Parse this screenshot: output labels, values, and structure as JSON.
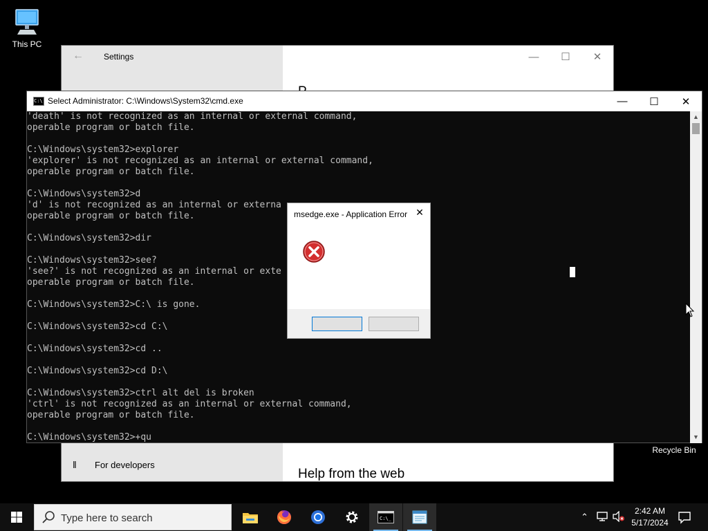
{
  "desktop": {
    "icons": [
      {
        "label": "This PC"
      },
      {
        "label": "Recycle Bin"
      }
    ]
  },
  "settings": {
    "title": "Settings",
    "partial_heading": "P",
    "dev_item": "For developers",
    "help_heading": "Help from the web"
  },
  "cmd": {
    "title": "Select Administrator: C:\\Windows\\System32\\cmd.exe",
    "lines": [
      "'death' is not recognized as an internal or external command,",
      "operable program or batch file.",
      "",
      "C:\\Windows\\system32>explorer",
      "'explorer' is not recognized as an internal or external command,",
      "operable program or batch file.",
      "",
      "C:\\Windows\\system32>d",
      "'d' is not recognized as an internal or externa",
      "operable program or batch file.",
      "",
      "C:\\Windows\\system32>dir",
      "",
      "C:\\Windows\\system32>see?",
      "'see?' is not recognized as an internal or exte",
      "operable program or batch file.",
      "",
      "C:\\Windows\\system32>C:\\ is gone.",
      "",
      "C:\\Windows\\system32>cd C:\\",
      "",
      "C:\\Windows\\system32>cd ..",
      "",
      "C:\\Windows\\system32>cd D:\\",
      "",
      "C:\\Windows\\system32>ctrl alt del is broken",
      "'ctrl' is not recognized as an internal or external command,",
      "operable program or batch file.",
      "",
      "C:\\Windows\\system32>+qu"
    ]
  },
  "dialog": {
    "title": "msedge.exe - Application Error",
    "button1_label": "",
    "button2_label": ""
  },
  "taskbar": {
    "search_placeholder": "Type here to search",
    "apps": [
      {
        "name": "file-explorer-icon"
      },
      {
        "name": "firefox-icon"
      },
      {
        "name": "chrome-icon"
      },
      {
        "name": "settings-gear-icon"
      },
      {
        "name": "cmd-icon"
      },
      {
        "name": "notepad-icon"
      }
    ],
    "time": "2:42 AM",
    "date": "5/17/2024"
  },
  "colors": {
    "error_red": "#d32f2f",
    "accent_blue": "#0078d7",
    "taskbar_bg": "#101010",
    "console_text": "#c0c0c0"
  }
}
